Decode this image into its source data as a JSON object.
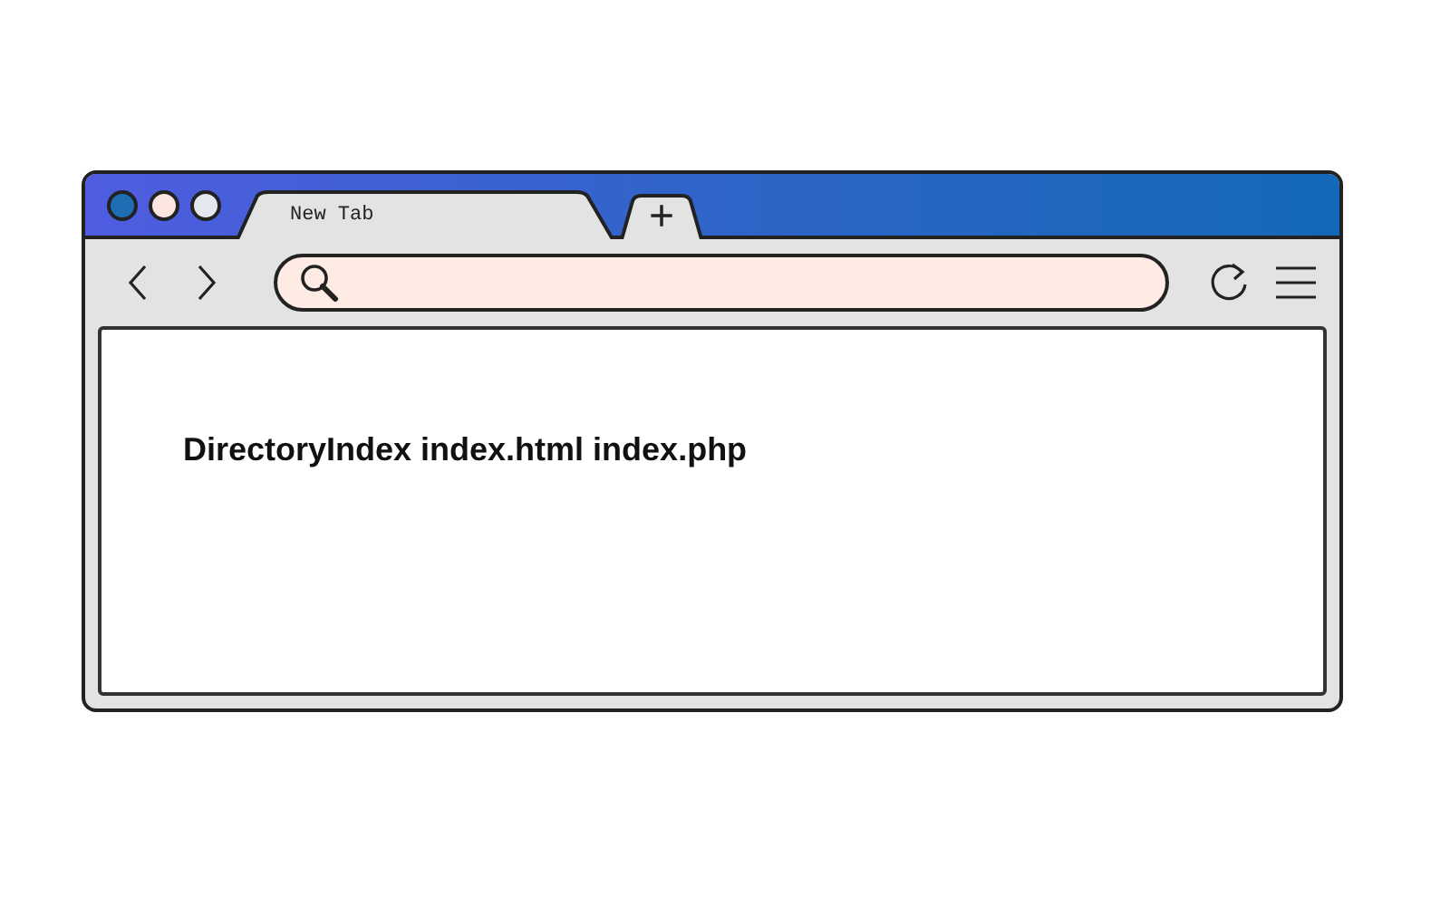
{
  "window": {
    "controls": [
      {
        "color": "#1f6db3"
      },
      {
        "color": "#fde6df"
      },
      {
        "color": "#e4e8ee"
      }
    ]
  },
  "tabs": [
    {
      "label": "New Tab",
      "selected": true
    }
  ],
  "new_tab_button": {
    "label": "+"
  },
  "content": {
    "text": "DirectoryIndex index.html index.php"
  }
}
